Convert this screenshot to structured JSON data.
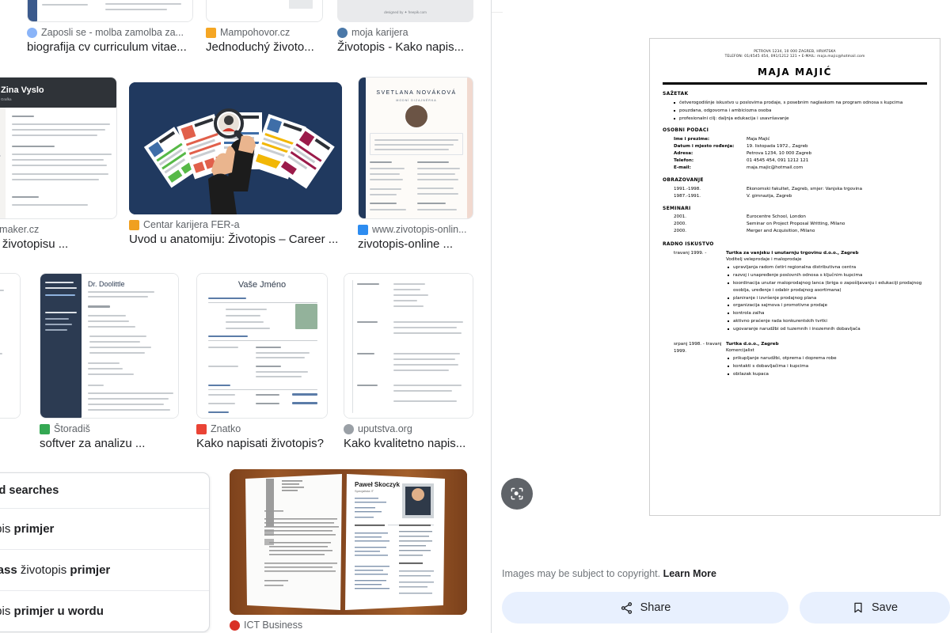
{
  "results": {
    "row1": [
      {
        "source": "Zaposli se - molba zamolba za...",
        "title": "biografija cv curriculum vitae...",
        "favicon_name": "globe-favicon",
        "favicon_color": "#8ab4f8",
        "thumb_name": "cv-thumbnail-blue-sidebar"
      },
      {
        "source": "Mampohovor.cz",
        "title": "Jednoduchý životo...",
        "favicon_name": "bird-favicon",
        "favicon_color": "#f5a623",
        "thumb_name": "cv-thumbnail-plain"
      },
      {
        "source": "moja karijera",
        "title": "Životopis - Kako napis...",
        "favicon_name": "wordpress-favicon",
        "favicon_color": "#4a78a8",
        "thumb_name": "cv-thumbnail-teal-header"
      }
    ],
    "row2": [
      {
        "source": "Resumaker.cz",
        "title": "Příklad životopisu ...",
        "favicon_name": "document-favicon",
        "favicon_color": "#9fb8d8",
        "thumb_name": "cv-thumbnail-zina-vyslo"
      },
      {
        "source": "Centar karijera FER-a",
        "title": "Uvod u anatomiju: Životopis – Career ...",
        "favicon_name": "hand-favicon",
        "favicon_color": "#f0a020",
        "thumb_name": "illustration-hands-holding-resumes"
      },
      {
        "source": "www.zivotopis-onlin...",
        "title": "zivotopis-online ...",
        "favicon_name": "page-favicon",
        "favicon_color": "#2d8cf0",
        "thumb_name": "cv-thumbnail-svetlana-novakova"
      }
    ],
    "row3": [
      {
        "source": "Štoradiš",
        "title": "softver za analizu ...",
        "favicon_name": "leaf-favicon",
        "favicon_color": "#34a853",
        "thumb_name": "cv-thumbnail-dr-doolittle"
      },
      {
        "source": "Znatko",
        "title": "Kako napisati životopis?",
        "favicon_name": "z-favicon",
        "favicon_color": "#ea4335",
        "thumb_name": "cv-thumbnail-vase-jmeno"
      },
      {
        "source": "uputstva.org",
        "title": "Kako kvalitetno napis...",
        "favicon_name": "globe-favicon",
        "favicon_color": "#9aa0a6",
        "thumb_name": "cv-thumbnail-grey-table"
      }
    ],
    "row4": [
      {
        "source": "ICT Business",
        "title": "",
        "favicon_name": "sphere-favicon",
        "favicon_color": "#d93025",
        "thumb_name": "photo-open-binder-with-cv"
      }
    ]
  },
  "related_searches": {
    "heading": "Related searches",
    "items": [
      {
        "plain_prefix": "životopis ",
        "bold": "primjer",
        "plain_suffix": ""
      },
      {
        "plain_prefix": "",
        "bold": "europass",
        "plain_mid": " životopis ",
        "bold2": "primjer"
      },
      {
        "plain_prefix": "životopis ",
        "bold": "primjer u wordu",
        "plain_suffix": ""
      }
    ]
  },
  "detail": {
    "lens_button_label": "lens-search",
    "copyright_text": "Images may be subject to copyright.",
    "learn_more": "Learn More",
    "share_label": "Share",
    "save_label": "Save"
  },
  "cv": {
    "contact_line1": "PETROVA 1234, 10 000 ZAGREB, HRVATSKA",
    "contact_line2": "TELEFON: 01/4545 454, 091/1212 121 • E-MAIL: maja.majic@hotmail.com",
    "name": "MAJA MAJIĆ",
    "sections": {
      "summary_heading": "SAŽETAK",
      "summary_items": [
        "četverogodišnje iskustvo u poslovima prodaje, s posebnim naglaskom na program odnosa s kupcima",
        "pouzdana, odgovorna i ambiciozna osoba",
        "profesionalni cilj: daljnja edukacija i usavršavanje"
      ],
      "personal_heading": "OSOBNI PODACI",
      "personal_rows": [
        {
          "label": "Ime i prezime:",
          "value": "Maja Majić"
        },
        {
          "label": "Datum i mjesto rođenja:",
          "value": "19. listopada 1972., Zagreb"
        },
        {
          "label": "Adresa:",
          "value": "Petrova 1234, 10 000 Zagreb"
        },
        {
          "label": "Telefon:",
          "value": "01 4545 454, 091 1212 121"
        },
        {
          "label": "E-mail:",
          "value": "maja.majic@hotmail.com"
        }
      ],
      "education_heading": "OBRAZOVANJE",
      "education_rows": [
        {
          "label": "1991.-1998.",
          "value": "Ekonomski fakultet, Zagreb, smjer: Vanjska trgovina"
        },
        {
          "label": "1987.-1991.",
          "value": "V. gimnazija, Zagreb"
        }
      ],
      "seminars_heading": "SEMINARI",
      "seminars_rows": [
        {
          "label": "2001.",
          "value": "Eurocentre School, London"
        },
        {
          "label": "2000.",
          "value": "Seminar on Project Proposal Writting, Milano"
        },
        {
          "label": "2000.",
          "value": "Merger and Acquisition, Milano"
        }
      ],
      "experience_heading": "RADNO ISKUSTVO",
      "jobs": [
        {
          "when": "travanj 1999. -",
          "company": "Turtka za vanjsku i unutarnju trgovinu d.o.o., Zagreb",
          "role": "Voditelj veleprodaje i maloprodaje",
          "duties": [
            "upravljanja radom četiri regionalna distributivna centra",
            "razvoj i unapređenje poslovnih odnosa s ključnim kupcima",
            "koordinacija unutar maloprodajnog lanca (briga o zapošljavanju i edukaciji prodajnog osoblja, uređenje i odabir prodajnog asortimana)",
            "planiranje i izvršenje prodajnog plana",
            "organizacija sajmova i promotivne prodaje",
            "kontrola zalha",
            "aktivno praćenje rada konkurentskih tvrtki",
            "ugovaranje narudžbi od tuzemnih i inozemnih dobavljača"
          ]
        },
        {
          "when": "srpanj 1998. - travanj 1999.",
          "company": "Turtka d.o.o., Zagreb",
          "role": "Komercijalist",
          "duties": [
            "prikupljanje narudžbi, otprema i doprema robe",
            "kontakti s dobavljačima i kupcima",
            "obilazak kupaca"
          ]
        }
      ]
    }
  }
}
